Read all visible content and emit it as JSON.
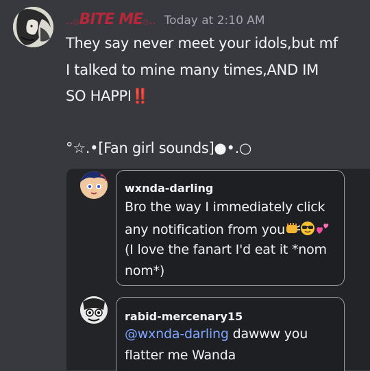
{
  "message": {
    "username_prefix": "..۞",
    "username": "BITE ME",
    "username_suffix": "۞..",
    "timestamp": "Today at 2:10 AM",
    "lines": [
      "They say never meet your idols,but mf",
      "I talked to mine many times,AND IM",
      "SO HAPPI"
    ],
    "exclaim": "‼️",
    "sounds": "°☆.•[Fan girl sounds]●•.○"
  },
  "replies": [
    {
      "username": "wxnda-darling",
      "lines": [
        "Bro the way I immediately click",
        "any notification from you",
        "(I love the fanart I'd eat it *nom",
        "nom*)"
      ],
      "emoji_names": [
        "punch-emoji",
        "sunglasses-emoji",
        "two-hearts-emoji"
      ]
    },
    {
      "username": "rabid-mercenary15",
      "mention": "@wxnda-darling",
      "line1_rest": " dawww you",
      "line2": "flatter me Wanda"
    }
  ],
  "colors": {
    "background": "#38393f",
    "username": "#b5283a",
    "timestamp": "#a3a6ad",
    "mention": "#7fa7ff",
    "embed_bg": "#232428",
    "bubble_bg": "#1e1f22"
  }
}
